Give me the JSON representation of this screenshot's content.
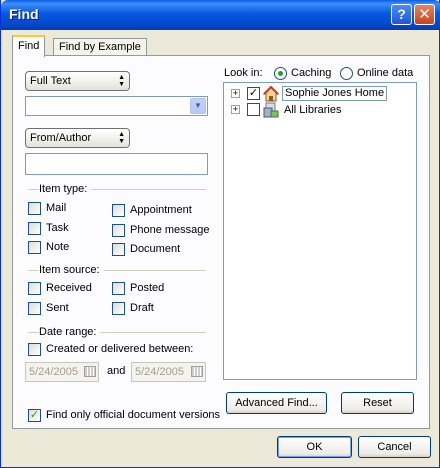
{
  "window": {
    "title": "Find",
    "help_glyph": "?",
    "close_glyph": "✕"
  },
  "tabs": [
    {
      "label": "Find",
      "active": true
    },
    {
      "label": "Find by Example",
      "active": false
    }
  ],
  "find": {
    "search_type": "Full Text",
    "search_text": "",
    "field_type": "From/Author",
    "field_value": ""
  },
  "item_type": {
    "label": "Item type:",
    "items": [
      {
        "label": "Mail",
        "checked": false
      },
      {
        "label": "Appointment",
        "checked": false
      },
      {
        "label": "Task",
        "checked": false
      },
      {
        "label": "Phone message",
        "checked": false
      },
      {
        "label": "Note",
        "checked": false
      },
      {
        "label": "Document",
        "checked": false
      }
    ]
  },
  "item_source": {
    "label": "Item source:",
    "items": [
      {
        "label": "Received",
        "checked": false
      },
      {
        "label": "Posted",
        "checked": false
      },
      {
        "label": "Sent",
        "checked": false
      },
      {
        "label": "Draft",
        "checked": false
      }
    ]
  },
  "date_range": {
    "label": "Date range:",
    "checkbox_label": "Created or delivered between:",
    "from": "5/24/2005",
    "and_label": "and",
    "to": "5/24/2005"
  },
  "official_versions": {
    "label": "Find only official document versions",
    "checked": true,
    "check_glyph": "✓"
  },
  "look_in": {
    "label": "Look in:",
    "options": [
      {
        "label": "Caching",
        "selected": true
      },
      {
        "label": "Online data",
        "selected": false
      }
    ],
    "tree": [
      {
        "label": "Sophie Jones Home",
        "checked": true,
        "icon": "home-icon",
        "expander": "+"
      },
      {
        "label": "All Libraries",
        "checked": false,
        "icon": "libraries-icon",
        "expander": "+"
      }
    ]
  },
  "buttons": {
    "advanced_find": "Advanced Find...",
    "reset": "Reset",
    "ok": "OK",
    "cancel": "Cancel"
  },
  "colors": {
    "titlebar": "#0659e0",
    "check": "#21a121",
    "dialog_bg": "#ece9d8"
  }
}
